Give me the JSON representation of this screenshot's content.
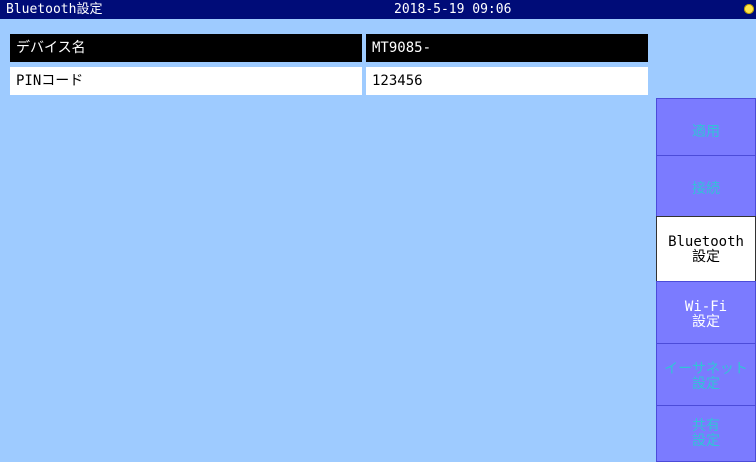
{
  "titlebar": {
    "title": "Bluetooth設定",
    "datetime": "2018-5-19 09:06",
    "status_icon": "battery-indicator-icon"
  },
  "settings": {
    "rows": [
      {
        "label": "デバイス名",
        "value": "MT9085-",
        "selected": true
      },
      {
        "label": "PINコード",
        "value": "123456",
        "selected": false
      }
    ]
  },
  "sidebar": {
    "buttons": [
      {
        "label": "適用"
      },
      {
        "label": "接続"
      },
      {
        "label": "Bluetooth\n設定"
      },
      {
        "label": "Wi-Fi\n設定"
      },
      {
        "label": "イーサネット\n設定"
      },
      {
        "label": "共有\n設定"
      }
    ]
  },
  "colors": {
    "titlebar_bg": "#000c78",
    "content_bg": "#9ecbff",
    "button_bg": "#7b7bff",
    "active_button_bg": "#ffffff"
  }
}
